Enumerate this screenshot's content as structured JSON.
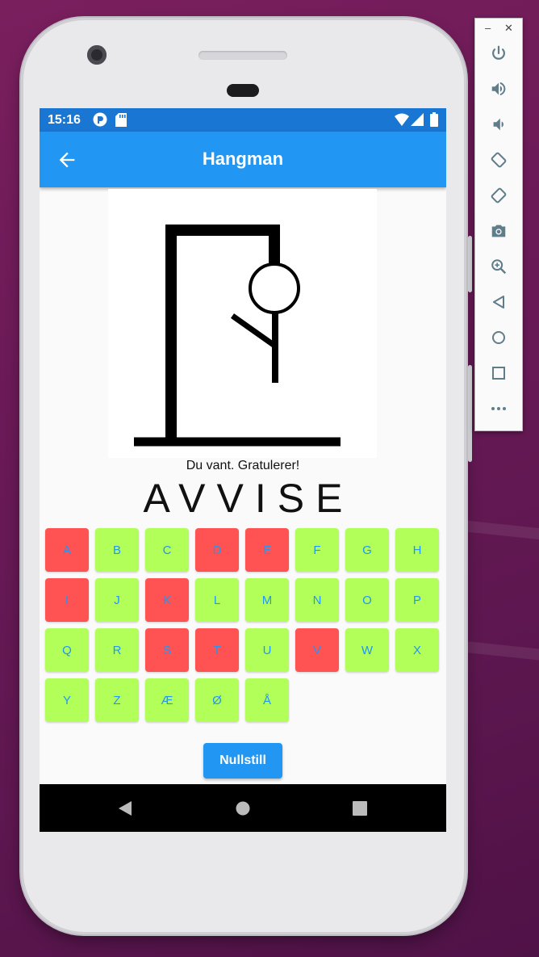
{
  "status_bar": {
    "time": "15:16"
  },
  "app_bar": {
    "title": "Hangman"
  },
  "game": {
    "message": "Du vant. Gratulerer!",
    "word": "AVVISE",
    "keys": [
      {
        "letter": "A",
        "state": "used"
      },
      {
        "letter": "B",
        "state": "available"
      },
      {
        "letter": "C",
        "state": "available"
      },
      {
        "letter": "D",
        "state": "used"
      },
      {
        "letter": "E",
        "state": "used"
      },
      {
        "letter": "F",
        "state": "available"
      },
      {
        "letter": "G",
        "state": "available"
      },
      {
        "letter": "H",
        "state": "available"
      },
      {
        "letter": "I",
        "state": "used"
      },
      {
        "letter": "J",
        "state": "available"
      },
      {
        "letter": "K",
        "state": "used"
      },
      {
        "letter": "L",
        "state": "available"
      },
      {
        "letter": "M",
        "state": "available"
      },
      {
        "letter": "N",
        "state": "available"
      },
      {
        "letter": "O",
        "state": "available"
      },
      {
        "letter": "P",
        "state": "available"
      },
      {
        "letter": "Q",
        "state": "available"
      },
      {
        "letter": "R",
        "state": "available"
      },
      {
        "letter": "S",
        "state": "used"
      },
      {
        "letter": "T",
        "state": "used"
      },
      {
        "letter": "U",
        "state": "available"
      },
      {
        "letter": "V",
        "state": "used"
      },
      {
        "letter": "W",
        "state": "available"
      },
      {
        "letter": "X",
        "state": "available"
      },
      {
        "letter": "Y",
        "state": "available"
      },
      {
        "letter": "Z",
        "state": "available"
      },
      {
        "letter": "Æ",
        "state": "available"
      },
      {
        "letter": "Ø",
        "state": "available"
      },
      {
        "letter": "Å",
        "state": "available"
      }
    ],
    "reset_label": "Nullstill"
  },
  "colors": {
    "app_bar": "#2196f3",
    "status_bar": "#1976d2",
    "key_available": "#b2ff59",
    "key_used": "#ff5252",
    "key_text": "#2196f3"
  },
  "emulator_toolbar": {
    "window_controls": [
      "minimize-icon",
      "close-icon"
    ],
    "tools": [
      "power-icon",
      "volume-up-icon",
      "volume-down-icon",
      "rotate-left-icon",
      "rotate-right-icon",
      "camera-icon",
      "zoom-icon",
      "back-icon",
      "home-icon",
      "overview-icon",
      "more-icon"
    ]
  }
}
